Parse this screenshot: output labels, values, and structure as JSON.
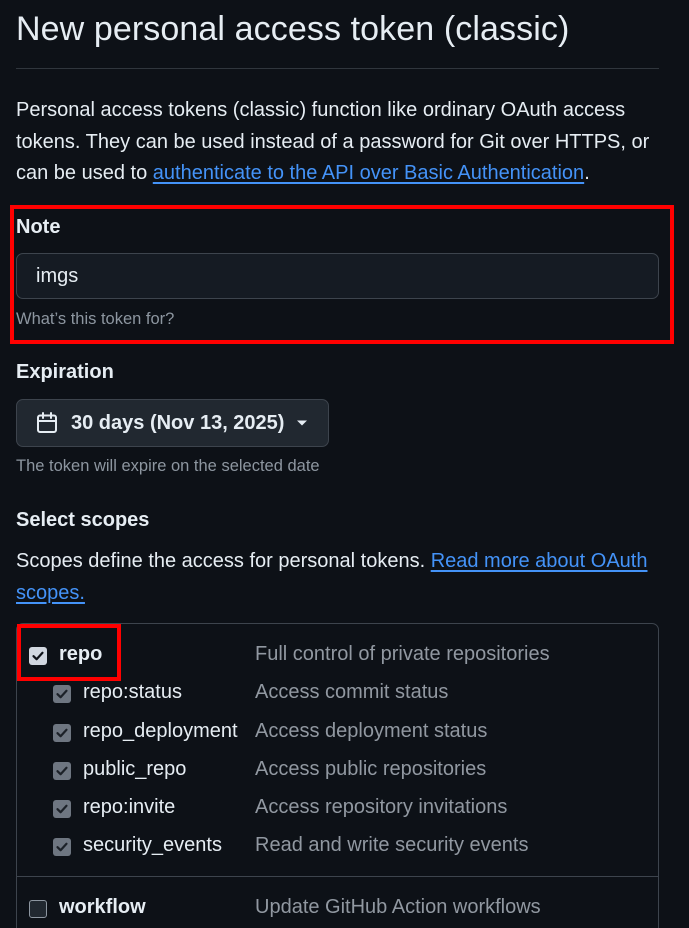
{
  "page": {
    "title": "New personal access token (classic)",
    "intro_text": "Personal access tokens (classic) function like ordinary OAuth access tokens. They can be used instead of a password for Git over HTTPS, or can be used to ",
    "intro_link": "authenticate to the API over Basic Authentication",
    "intro_end": "."
  },
  "note": {
    "label": "Note",
    "value": "imgs",
    "hint": "What’s this token for?"
  },
  "expiration": {
    "label": "Expiration",
    "selected": "30 days (Nov 13, 2025)",
    "hint": "The token will expire on the selected date"
  },
  "scopes": {
    "label": "Select scopes",
    "desc_text": "Scopes define the access for personal tokens. ",
    "desc_link": "Read more about OAuth scopes.",
    "items": [
      {
        "name": "repo",
        "desc": "Full control of private repositories",
        "checked": true,
        "parent": true
      },
      {
        "name": "repo:status",
        "desc": "Access commit status",
        "checked": true,
        "parent": false
      },
      {
        "name": "repo_deployment",
        "desc": "Access deployment status",
        "checked": true,
        "parent": false
      },
      {
        "name": "public_repo",
        "desc": "Access public repositories",
        "checked": true,
        "parent": false
      },
      {
        "name": "repo:invite",
        "desc": "Access repository invitations",
        "checked": true,
        "parent": false
      },
      {
        "name": "security_events",
        "desc": "Read and write security events",
        "checked": true,
        "parent": false
      },
      {
        "name": "workflow",
        "desc": "Update GitHub Action workflows",
        "checked": false,
        "parent": true
      }
    ]
  },
  "colors": {
    "background": "#0d1117",
    "link": "#4493f8",
    "highlight": "#ff0000"
  }
}
